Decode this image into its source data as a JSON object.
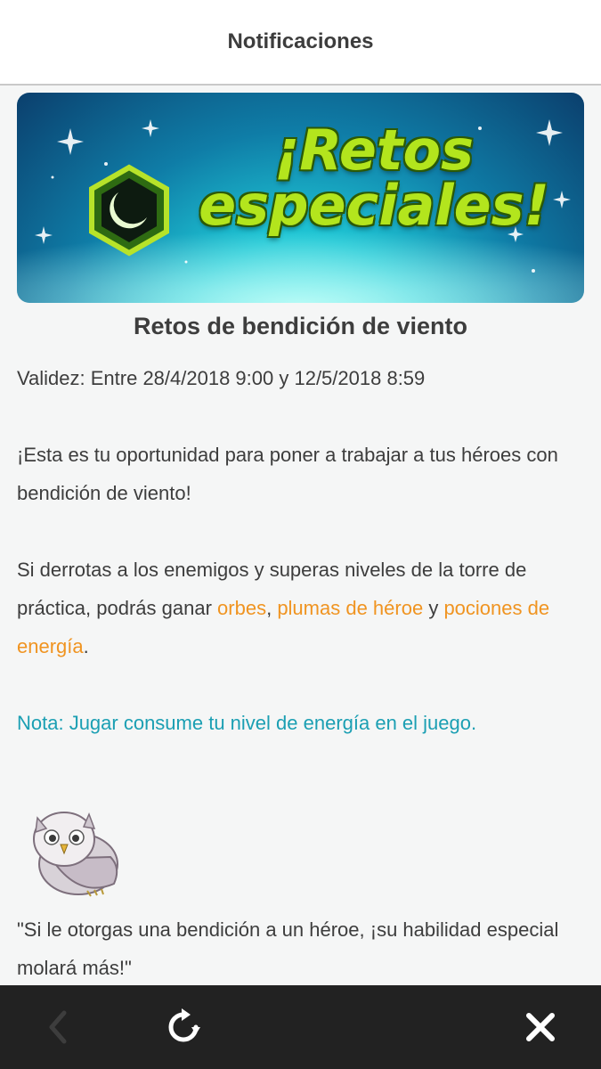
{
  "header": {
    "title": "Notificaciones"
  },
  "banner": {
    "line1": "¡Retos",
    "line2": "especiales!"
  },
  "event": {
    "title": "Retos de bendición de viento",
    "validity": "Validez: Entre 28/4/2018 9:00 y 12/5/2018 8:59"
  },
  "body": {
    "intro": "¡Esta es tu oportunidad para poner a trabajar a tus héroes con bendición de viento!",
    "rewards_prefix": "Si derrotas a los enemigos y superas niveles de la torre de práctica, podrás ganar ",
    "reward_orbs": "orbes",
    "sep1": ", ",
    "reward_feathers": "plumas de héroe",
    "sep2": " y ",
    "reward_potions": "pociones de energía",
    "end": ".",
    "note": "Nota: Jugar consume tu nivel de energía en el juego.",
    "quote": "\"Si le otorgas una bendición a un héroe, ¡su habilidad especial molará más!\""
  },
  "colors": {
    "link_orange": "#f09421",
    "note_teal": "#1b9fb3",
    "bottom_bar": "#222222"
  },
  "bottom_bar": {
    "back_icon": "chevron-left-icon",
    "refresh_icon": "refresh-icon",
    "close_icon": "close-icon"
  }
}
